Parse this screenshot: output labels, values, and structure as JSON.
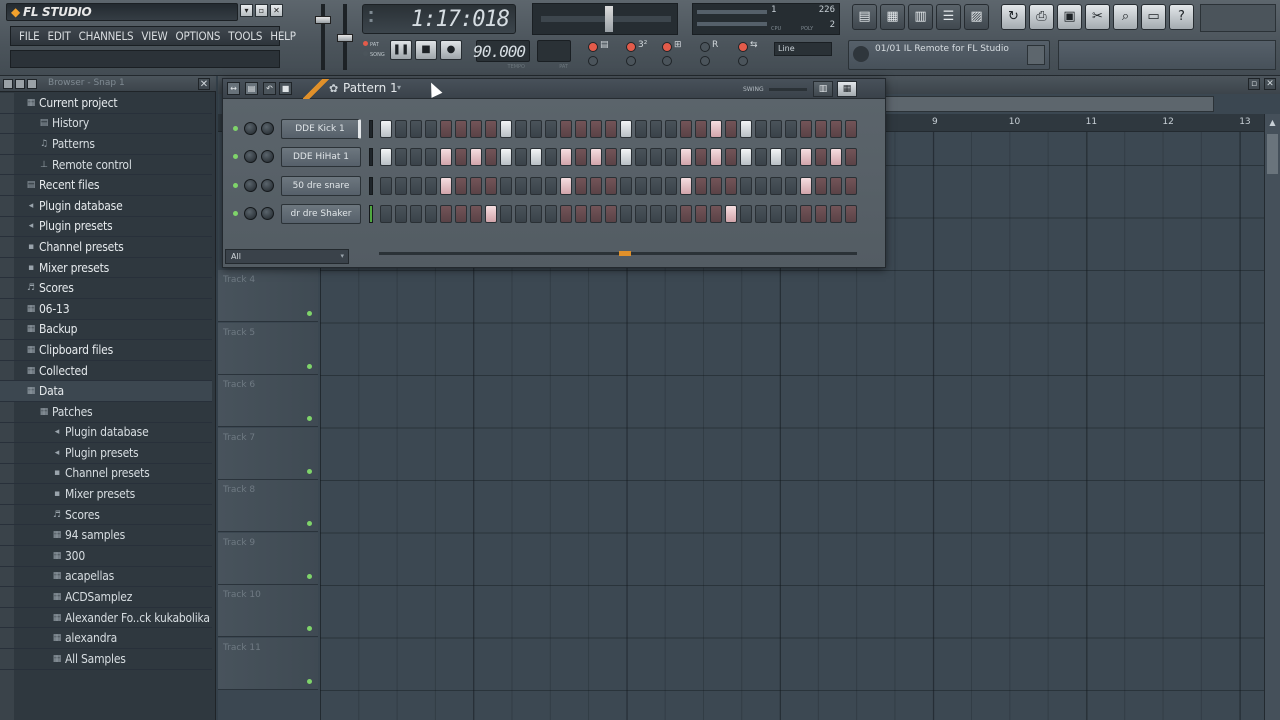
{
  "app": {
    "logo": "FL STUDIO"
  },
  "window_controls": [
    "▾",
    "▫",
    "✕"
  ],
  "menu": [
    "FILE",
    "EDIT",
    "CHANNELS",
    "VIEW",
    "OPTIONS",
    "TOOLS",
    "HELP"
  ],
  "time_display": {
    "value": "1:17:018"
  },
  "cpu_display": {
    "num1": "1",
    "num2": "226",
    "num3": "2",
    "cpu_label": "CPU",
    "poly_label": "POLY"
  },
  "transport": {
    "pause": "❚❚",
    "stop": "■",
    "record": "●",
    "pat_label": "PAT",
    "song_label": "SONG"
  },
  "tempo": {
    "value": "90.000",
    "label": "TEMPO"
  },
  "pattern_label": "PAT",
  "snap": {
    "value": "Line"
  },
  "hint_panel": {
    "text": "01/01  IL Remote for FL Studio"
  },
  "browser": {
    "title": "Browser - Snap 1",
    "items": [
      {
        "label": "Current project",
        "icon": "folder-icon",
        "level": 0
      },
      {
        "label": "History",
        "icon": "history-icon",
        "level": 1
      },
      {
        "label": "Patterns",
        "icon": "pattern-icon",
        "level": 1
      },
      {
        "label": "Remote control",
        "icon": "remote-icon",
        "level": 1
      },
      {
        "label": "Recent files",
        "icon": "recent-icon",
        "level": 0
      },
      {
        "label": "Plugin database",
        "icon": "plugin-icon",
        "level": 0
      },
      {
        "label": "Plugin presets",
        "icon": "plugin-icon",
        "level": 0
      },
      {
        "label": "Channel presets",
        "icon": "channel-icon",
        "level": 0
      },
      {
        "label": "Mixer presets",
        "icon": "mixer-icon",
        "level": 0
      },
      {
        "label": "Scores",
        "icon": "score-icon",
        "level": 0
      },
      {
        "label": "06-13",
        "icon": "folder-icon",
        "level": 0
      },
      {
        "label": "Backup",
        "icon": "folder-icon",
        "level": 0
      },
      {
        "label": "Clipboard files",
        "icon": "folder-icon",
        "level": 0
      },
      {
        "label": "Collected",
        "icon": "folder-icon",
        "level": 0
      },
      {
        "label": "Data",
        "icon": "folder-icon",
        "level": 0,
        "selected": true
      },
      {
        "label": "Patches",
        "icon": "folder-icon",
        "level": 1
      },
      {
        "label": "Plugin database",
        "icon": "plugin-icon",
        "level": 2
      },
      {
        "label": "Plugin presets",
        "icon": "plugin-icon",
        "level": 2
      },
      {
        "label": "Channel presets",
        "icon": "channel-icon",
        "level": 2
      },
      {
        "label": "Mixer presets",
        "icon": "mixer-icon",
        "level": 2
      },
      {
        "label": "Scores",
        "icon": "score-icon",
        "level": 2
      },
      {
        "label": "94 samples",
        "icon": "folder-icon",
        "level": 2
      },
      {
        "label": "300",
        "icon": "folder-icon",
        "level": 2
      },
      {
        "label": "acapellas",
        "icon": "folder-icon",
        "level": 2
      },
      {
        "label": "ACDSamplez",
        "icon": "folder-icon",
        "level": 2
      },
      {
        "label": "Alexander Fo..ck kukabolika",
        "icon": "folder-icon",
        "level": 2
      },
      {
        "label": "alexandra",
        "icon": "folder-icon",
        "level": 2
      },
      {
        "label": "All Samples",
        "icon": "folder-icon",
        "level": 2
      }
    ]
  },
  "playlist": {
    "ruler": [
      "9",
      "10",
      "11",
      "12",
      "13"
    ],
    "tracks": [
      "Track 4",
      "Track 5",
      "Track 6",
      "Track 7",
      "Track 8",
      "Track 9",
      "Track 10",
      "Track 11"
    ]
  },
  "channel_rack": {
    "pattern": "Pattern 1",
    "swing_label": "SWING",
    "filter": "All",
    "channels": [
      {
        "name": "DDE Kick 1",
        "selected": true,
        "steps": [
          1,
          0,
          0,
          0,
          0,
          0,
          0,
          0,
          1,
          0,
          0,
          0,
          0,
          0,
          0,
          0,
          1,
          0,
          0,
          0,
          0,
          0,
          1,
          0,
          1,
          0,
          0,
          0,
          0,
          0,
          0,
          0
        ]
      },
      {
        "name": "DDE HiHat 1",
        "selected": false,
        "steps": [
          1,
          0,
          0,
          0,
          1,
          0,
          1,
          0,
          1,
          0,
          1,
          0,
          1,
          0,
          1,
          0,
          1,
          0,
          0,
          0,
          1,
          0,
          1,
          0,
          1,
          0,
          1,
          0,
          1,
          0,
          1,
          0
        ]
      },
      {
        "name": "50 dre snare",
        "selected": false,
        "steps": [
          0,
          0,
          0,
          0,
          1,
          0,
          0,
          0,
          0,
          0,
          0,
          0,
          1,
          0,
          0,
          0,
          0,
          0,
          0,
          0,
          1,
          0,
          0,
          0,
          0,
          0,
          0,
          0,
          1,
          0,
          0,
          0
        ]
      },
      {
        "name": "dr dre Shaker",
        "selected": false,
        "steps": [
          0,
          0,
          0,
          0,
          0,
          0,
          0,
          1,
          0,
          0,
          0,
          0,
          0,
          0,
          0,
          0,
          0,
          0,
          0,
          0,
          0,
          0,
          0,
          1,
          0,
          0,
          0,
          0,
          0,
          0,
          0,
          0
        ]
      }
    ]
  },
  "colors": {
    "accent": "#e0902a",
    "step_on": "#f2f4f5",
    "step_red": "#735458",
    "led": "#7fd46a"
  }
}
